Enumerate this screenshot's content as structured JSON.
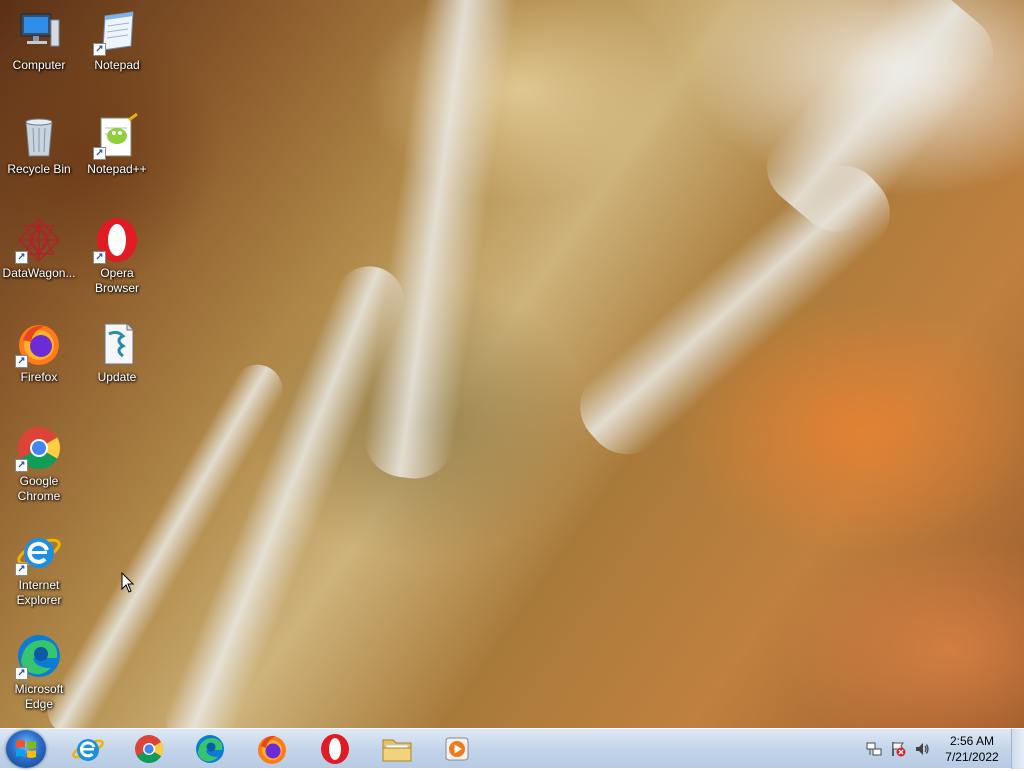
{
  "desktop": {
    "icons": [
      {
        "label": "Computer",
        "icon": "computer-icon"
      },
      {
        "label": "Notepad",
        "icon": "notepad-icon"
      },
      {
        "label": "Recycle Bin",
        "icon": "recycle-bin-icon"
      },
      {
        "label": "Notepad++",
        "icon": "notepadpp-icon"
      },
      {
        "label": "DataWagon...",
        "icon": "datawagon-icon"
      },
      {
        "label": "Opera Browser",
        "icon": "opera-icon"
      },
      {
        "label": "Firefox",
        "icon": "firefox-icon"
      },
      {
        "label": "Update",
        "icon": "update-script-icon"
      },
      {
        "label": "Google Chrome",
        "icon": "chrome-icon"
      },
      {
        "label": "Internet Explorer",
        "icon": "ie-icon"
      },
      {
        "label": "Microsoft Edge",
        "icon": "edge-icon"
      }
    ]
  },
  "taskbar": {
    "start_icon": "windows-start-icon",
    "pinned": [
      {
        "name": "Internet Explorer",
        "icon": "ie-icon"
      },
      {
        "name": "Google Chrome",
        "icon": "chrome-icon"
      },
      {
        "name": "Microsoft Edge",
        "icon": "edge-icon"
      },
      {
        "name": "Firefox",
        "icon": "firefox-icon"
      },
      {
        "name": "Opera",
        "icon": "opera-icon"
      },
      {
        "name": "File Explorer",
        "icon": "folder-icon"
      },
      {
        "name": "Media Player",
        "icon": "media-player-icon"
      }
    ],
    "tray": {
      "icons": [
        "network-icon",
        "action-center-icon",
        "volume-icon"
      ],
      "time": "2:56 AM",
      "date": "7/21/2022"
    }
  },
  "colors": {
    "taskbar": "#c4d5ea",
    "label_text": "#ffffff"
  }
}
